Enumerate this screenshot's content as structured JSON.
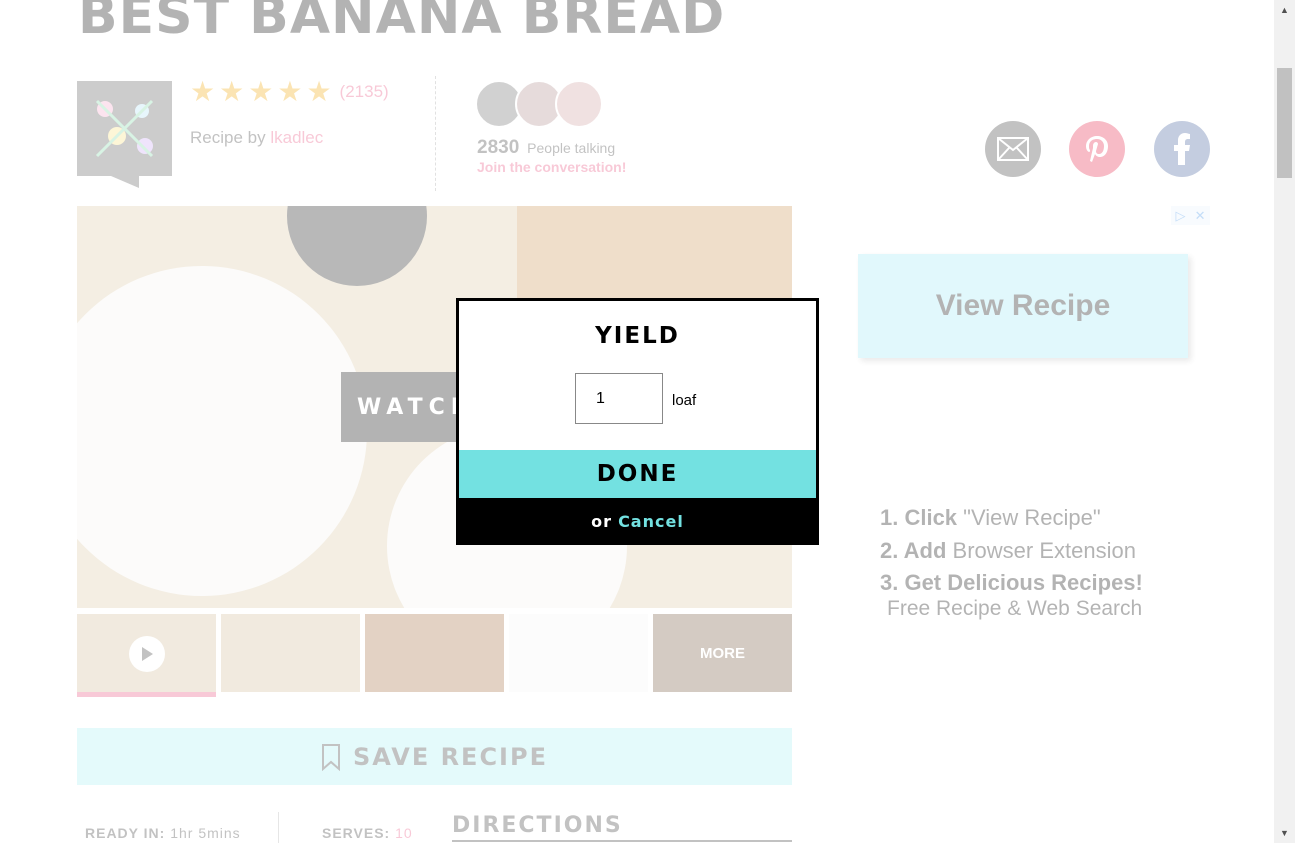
{
  "recipe": {
    "title": "BEST BANANA BREAD",
    "rating_count": "(2135)",
    "recipe_by": "Recipe by",
    "author": "lkadlec",
    "people_count": "2830",
    "people_label": "People talking",
    "join_text": "Join the conversation!"
  },
  "media": {
    "watch_label": "WATCH",
    "more_label": "MORE"
  },
  "save_label": "SAVE RECIPE",
  "meta": {
    "ready_label": "READY IN:",
    "ready_value": "1hr 5mins",
    "serves_label": "SERVES:",
    "serves_value": "10",
    "directions_label": "DIRECTIONS"
  },
  "ad": {
    "button_text": "View Recipe",
    "step1_bold": "1. Click",
    "step1_rest": "\"View Recipe\"",
    "step2_bold": "2. Add",
    "step2_rest": "Browser Extension",
    "step3_bold": "3. Get Delicious Recipes!",
    "footer": "Free Recipe & Web Search",
    "choices_icons": [
      "ad-info-icon",
      "ad-close-icon"
    ]
  },
  "modal": {
    "title": "YIELD",
    "input_value": "1",
    "unit": "loaf",
    "done_label": "DONE",
    "or_text": "or",
    "cancel_label": "Cancel"
  },
  "colors": {
    "accent_pink": "#e84c7a",
    "accent_teal": "#73e1e1",
    "star": "#f0a500"
  }
}
